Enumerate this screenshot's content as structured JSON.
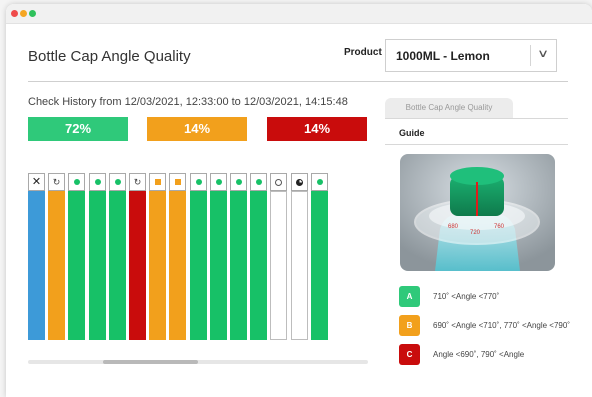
{
  "window": {
    "title": ""
  },
  "page": {
    "title": "Bottle Cap Angle Quality"
  },
  "product": {
    "label": "Product",
    "value": "1000ML - Lemon"
  },
  "history": {
    "text": "Check History from 12/03/2021, 12:33:00 to 12/03/2021, 14:15:48"
  },
  "summary": {
    "a_percent": "72%",
    "b_percent": "14%",
    "c_percent": "14%"
  },
  "colors": {
    "grade_a": "#2fc97a",
    "grade_b": "#f2a01c",
    "grade_c": "#c90c0c",
    "blue": "#3d9ad8",
    "status_green": "#17c167"
  },
  "checks": [
    {
      "status_icon": "x-icon",
      "color": "#3d9ad8"
    },
    {
      "status_icon": "refresh-icon",
      "color": "#f2a01c"
    },
    {
      "status_icon": "green-dot-icon",
      "color": "#17c167"
    },
    {
      "status_icon": "green-dot-icon",
      "color": "#17c167"
    },
    {
      "status_icon": "green-dot-icon",
      "color": "#17c167"
    },
    {
      "status_icon": "refresh-icon",
      "color": "#c90c0c"
    },
    {
      "status_icon": "orange-square-icon",
      "color": "#f2a01c"
    },
    {
      "status_icon": "orange-square-icon",
      "color": "#f2a01c"
    },
    {
      "status_icon": "green-dot-icon",
      "color": "#17c167"
    },
    {
      "status_icon": "green-dot-icon",
      "color": "#17c167"
    },
    {
      "status_icon": "green-dot-icon",
      "color": "#17c167"
    },
    {
      "status_icon": "green-dot-icon",
      "color": "#17c167"
    },
    {
      "status_icon": "clock-icon",
      "color": "#ffffff"
    },
    {
      "status_icon": "pie-icon",
      "color": "#ffffff"
    },
    {
      "status_icon": "green-dot-icon",
      "color": "#17c167"
    }
  ],
  "side_panel": {
    "tab_label": "Bottle Cap Angle Quality",
    "guide_label": "Guide"
  },
  "legend": [
    {
      "grade": "A",
      "text": "710˚ <Angle <770˚",
      "color": "#2fc97a"
    },
    {
      "grade": "B",
      "text": "690˚ <Angle <710˚,  770˚ <Angle <790˚",
      "color": "#f2a01c"
    },
    {
      "grade": "C",
      "text": "Angle <690˚,  790˚ <Angle",
      "color": "#c90c0c"
    }
  ]
}
